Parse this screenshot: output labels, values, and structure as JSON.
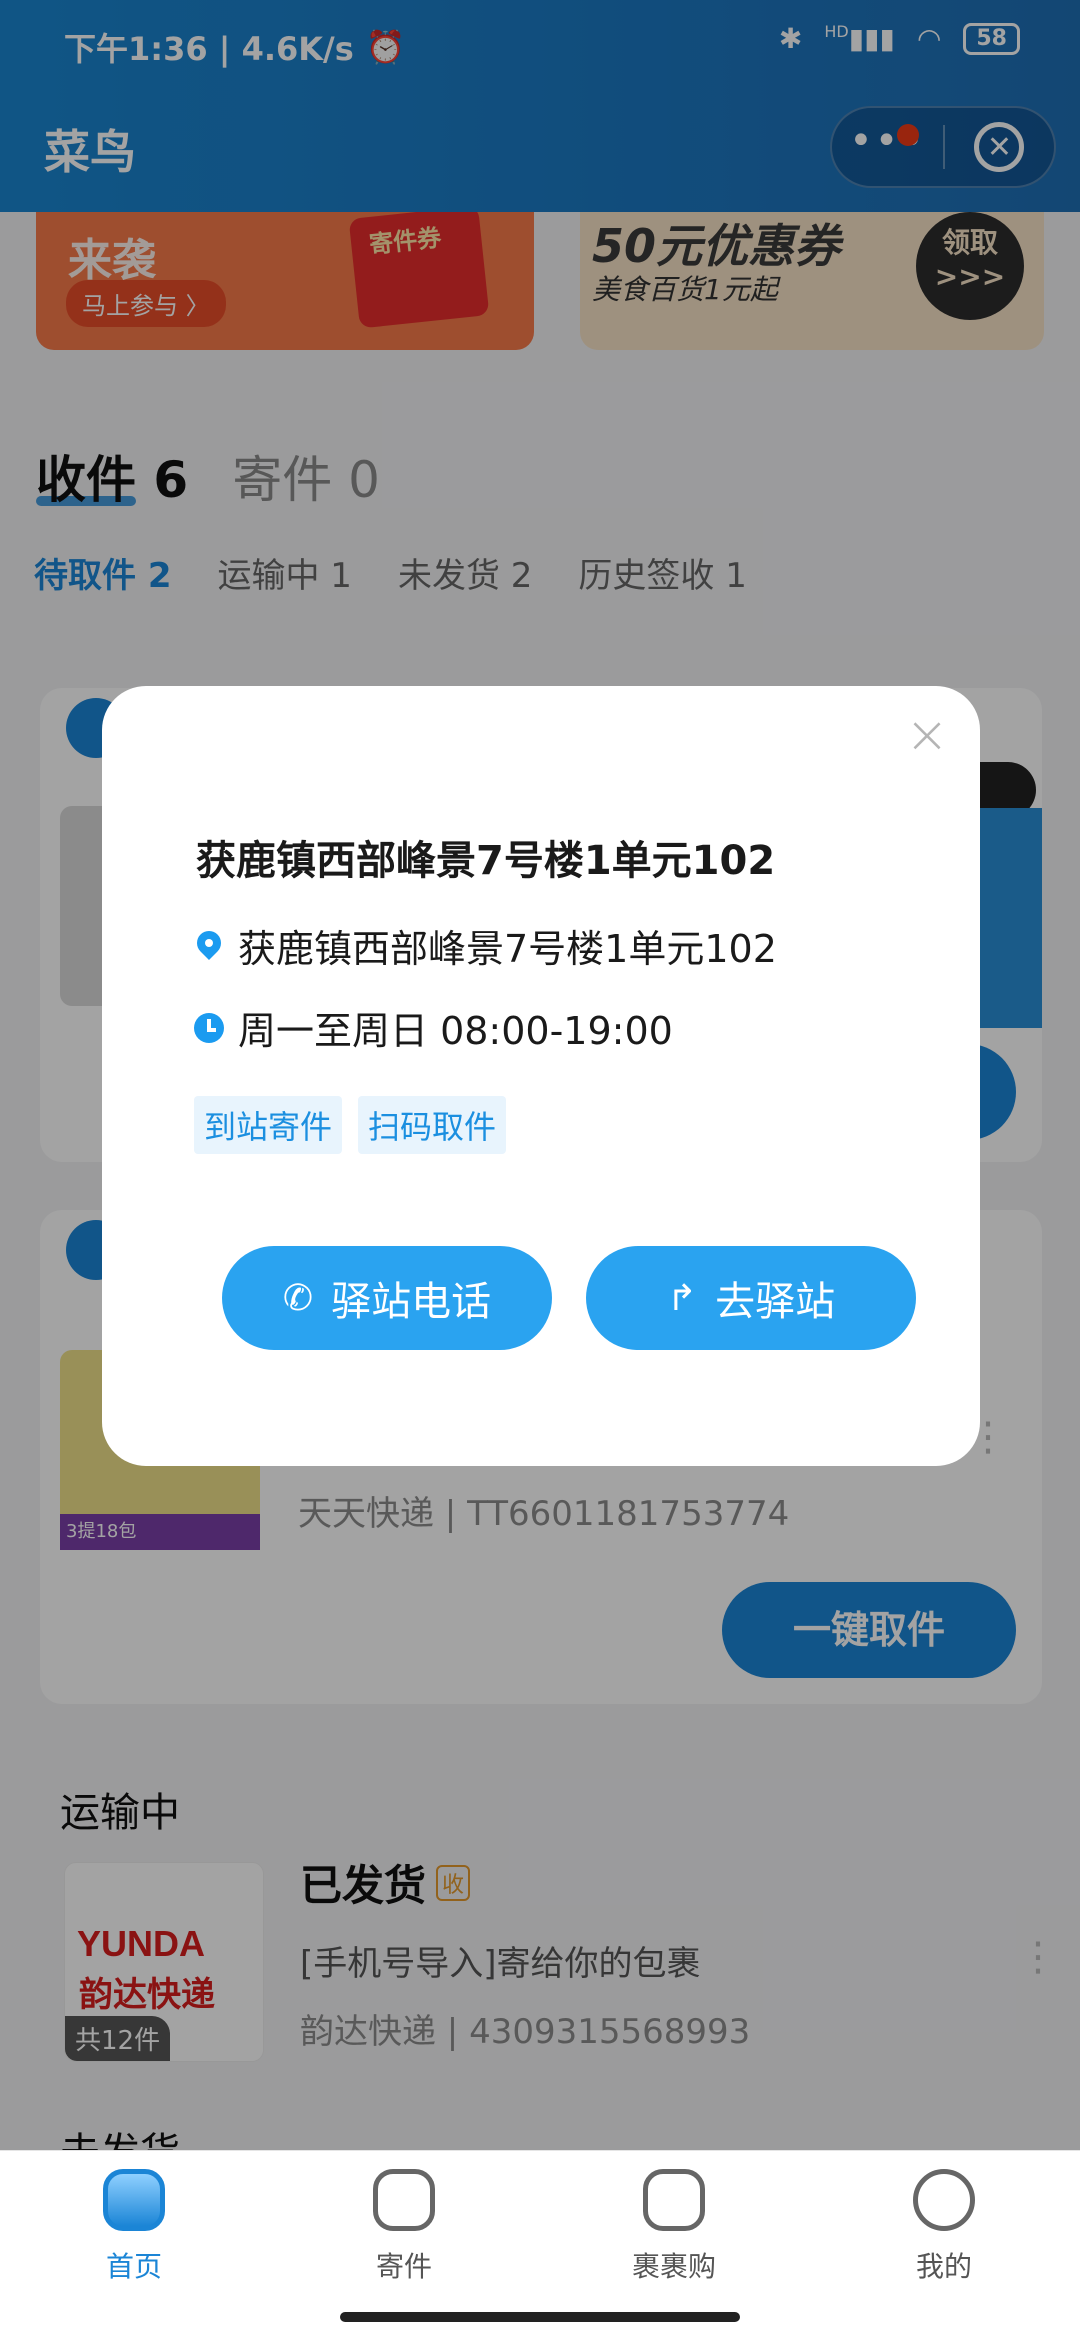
{
  "status_bar": {
    "time": "下午1:36 | 4.6K/s",
    "alarm_icon": "alarm-icon",
    "bluetooth_icon": "bluetooth-icon",
    "signal": "HD",
    "battery": "58"
  },
  "header": {
    "title": "菜鸟"
  },
  "banners": [
    {
      "title": "来袭",
      "button": "马上参与 〉",
      "coupon_label": "寄件券"
    },
    {
      "title": "50元优惠券",
      "subtitle": "美食百货1元起",
      "button": "领取 >>>"
    }
  ],
  "main_tabs": [
    {
      "label": "收件 6",
      "active": true
    },
    {
      "label": "寄件 0",
      "active": false
    }
  ],
  "sub_tabs": [
    {
      "label": "待取件 2",
      "active": true
    },
    {
      "label": "运输中 1",
      "active": false
    },
    {
      "label": "未发货 2",
      "active": false
    },
    {
      "label": "历史签收 1",
      "active": false
    }
  ],
  "cards": [
    {
      "meta": ""
    },
    {
      "meta": "天天快递 | TT6601181753774",
      "action": "一键取件",
      "thumb_label": "3提18包"
    }
  ],
  "in_transit": {
    "section_title": "运输中",
    "item": {
      "brand_en": "YUNDA",
      "brand_cn": "韵达快递",
      "count": "共12件",
      "status": "已发货",
      "status_tag": "收",
      "desc": "[手机号导入]寄给你的包裹",
      "meta": "韵达快递 | 4309315568993"
    },
    "next_section_title": "未发货"
  },
  "modal": {
    "title": "获鹿镇西部峰景7号楼1单元102",
    "address": "获鹿镇西部峰景7号楼1单元102",
    "hours": "周一至周日 08:00-19:00",
    "tags": [
      "到站寄件",
      "扫码取件"
    ],
    "call_button": "驿站电话",
    "go_button": "去驿站"
  },
  "bottom_nav": [
    {
      "label": "首页",
      "icon": "home-icon",
      "active": true
    },
    {
      "label": "寄件",
      "icon": "mailbox-icon",
      "active": false
    },
    {
      "label": "裹裹购",
      "icon": "shopping-bag-icon",
      "active": false
    },
    {
      "label": "我的",
      "icon": "profile-icon",
      "active": false
    }
  ],
  "colors": {
    "accent": "#1b85d6",
    "modal_button": "#2aa3f0",
    "header": "#1c78c2"
  }
}
